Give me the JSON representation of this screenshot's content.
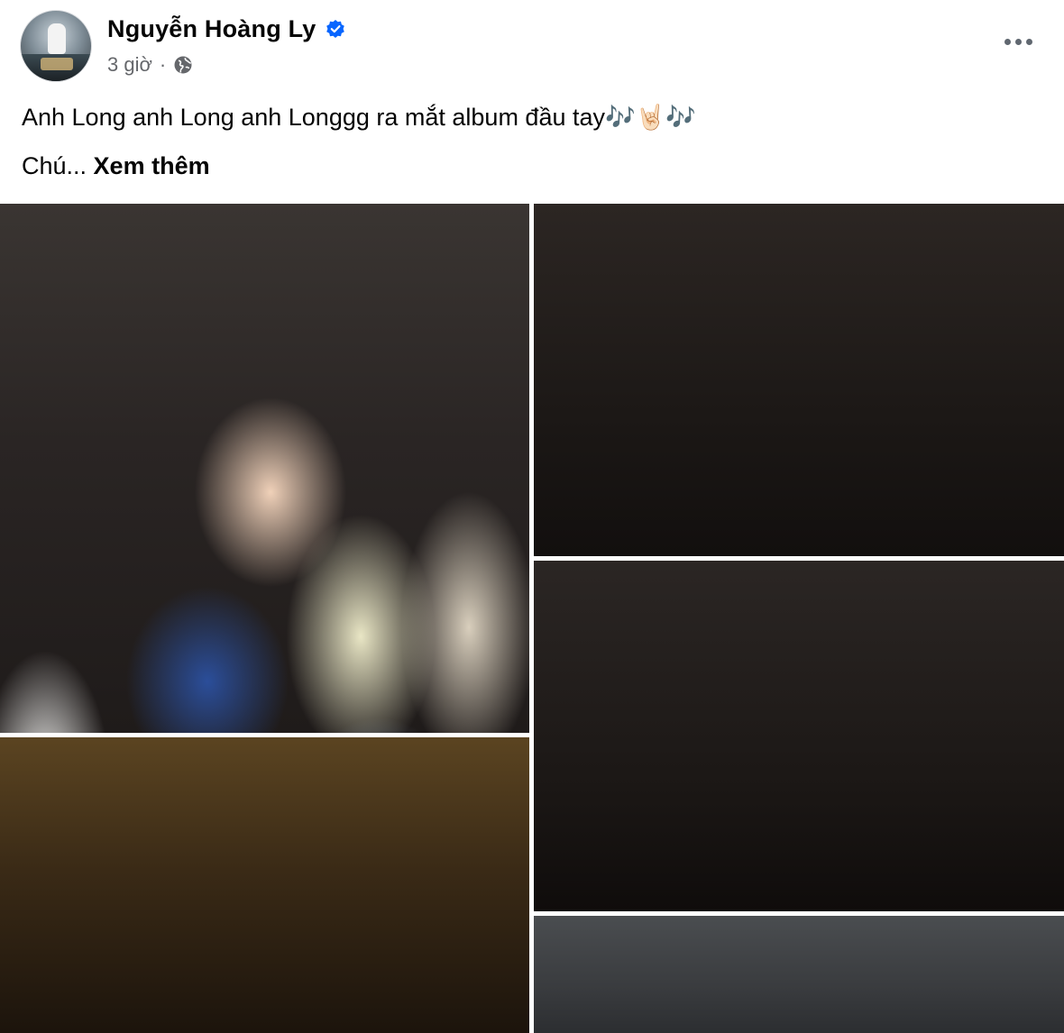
{
  "post": {
    "author": "Nguyễn Hoàng Ly",
    "verified_icon": "verified-badge-icon",
    "time": "3 giờ",
    "separator": "·",
    "privacy_icon": "globe-icon",
    "more_icon": "more-options-icon",
    "text_line1": "Anh Long anh Long anh Longgg ra mắt album đầu tay🎶🤘🏻🎶",
    "text_line2_prefix": "Chú... ",
    "see_more": "Xem thêm"
  },
  "photos": [
    {
      "name": "photo-1"
    },
    {
      "name": "photo-2"
    },
    {
      "name": "photo-3"
    },
    {
      "name": "photo-4"
    },
    {
      "name": "photo-5"
    }
  ],
  "colors": {
    "text": "#050505",
    "secondary_text": "#65676b",
    "verified": "#0866ff"
  }
}
